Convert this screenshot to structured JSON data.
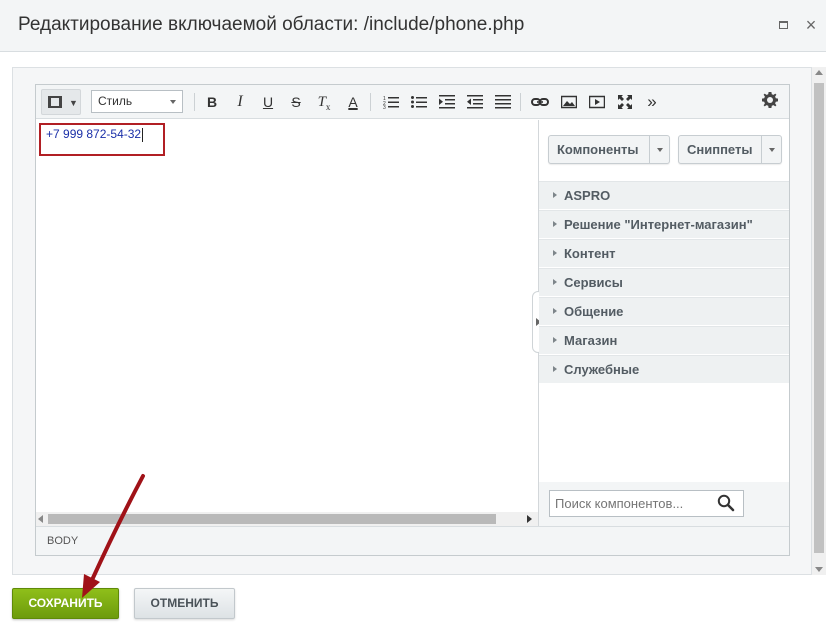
{
  "dialog": {
    "title": "Редактирование включаемой области: /include/phone.php"
  },
  "toolbar": {
    "style_select_value": "Стиль",
    "buttons": [
      "bold-button",
      "italic-button",
      "underline-button",
      "strike-button",
      "remove-format-button",
      "font-color-button",
      "ordered-list-button",
      "unordered-list-button",
      "indent-button",
      "outdent-button",
      "align-button",
      "link-button",
      "image-button",
      "video-button",
      "fullscreen-button",
      "more-button"
    ],
    "bold_label": "B",
    "italic_label": "I",
    "underline_label": "U",
    "strike_label": "S",
    "remove_format_label": "T",
    "remove_format_sub": "x",
    "font_color_label": "A",
    "more_label": "»"
  },
  "editor": {
    "content": "+7 999 872-54-32",
    "highlight_color": "#b11f24",
    "text_color": "#1a2fa8"
  },
  "side_panel": {
    "tabs": [
      {
        "label": "Компоненты"
      },
      {
        "label": "Сниппеты"
      }
    ],
    "groups": [
      {
        "label": "ASPRO"
      },
      {
        "label": "Решение \"Интернет-магазин\""
      },
      {
        "label": "Контент"
      },
      {
        "label": "Сервисы"
      },
      {
        "label": "Общение"
      },
      {
        "label": "Магазин"
      },
      {
        "label": "Служебные"
      }
    ],
    "search_placeholder": "Поиск компонентов..."
  },
  "statusbar": {
    "path": "BODY"
  },
  "footer": {
    "save_label": "СОХРАНИТЬ",
    "cancel_label": "ОТМЕНИТЬ",
    "save_color": "#7aab10"
  },
  "annotation": {
    "arrow_color": "#a01218"
  }
}
